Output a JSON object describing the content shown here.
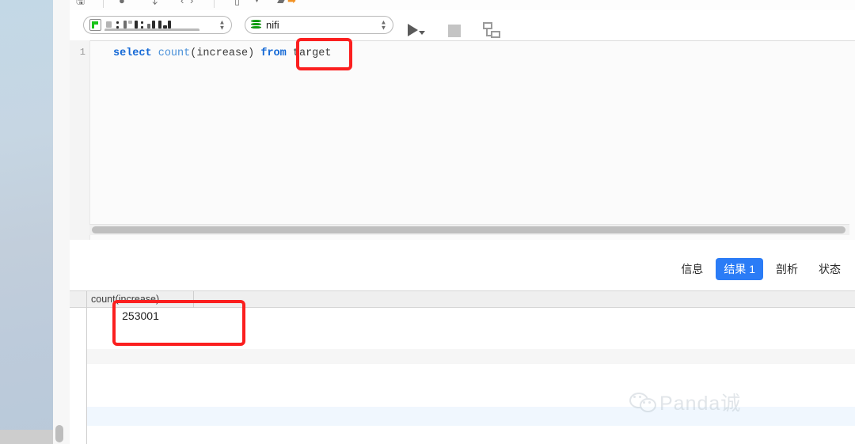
{
  "window": {
    "top_toolbar": {
      "icons": [
        "save-icon",
        "divider",
        "commit-icon",
        "rollback-icon",
        "navigate-back-icon",
        "navigate-forward-icon",
        "divider",
        "table-icon",
        "chevron-down-icon",
        "export-icon"
      ]
    }
  },
  "query_toolbar": {
    "connection": {
      "icon": "connection-icon",
      "label": "",
      "redacted": true,
      "stepper_up": "▲",
      "stepper_down": "▼"
    },
    "schema": {
      "icon": "database-icon",
      "label": "nifi",
      "stepper_up": "▲",
      "stepper_down": "▼"
    },
    "run_button_label": "run-query",
    "stop_button_label": "stop-query",
    "explain_plan_button_label": "explain-plan"
  },
  "editor": {
    "line_number": "1",
    "sql_tokens": [
      {
        "text": "select",
        "type": "keyword"
      },
      {
        "text": " ",
        "type": "plain"
      },
      {
        "text": "count",
        "type": "function"
      },
      {
        "text": "(increase) ",
        "type": "plain"
      },
      {
        "text": "from",
        "type": "keyword"
      },
      {
        "text": " ",
        "type": "plain"
      },
      {
        "text": "target",
        "type": "identifier"
      }
    ],
    "sql_text": "select count(increase) from target"
  },
  "results": {
    "tabs": [
      {
        "label": "信息",
        "active": false
      },
      {
        "label": "结果 1",
        "active": true
      },
      {
        "label": "剖析",
        "active": false
      },
      {
        "label": "状态",
        "active": false
      }
    ],
    "columns": [
      "count(increase)"
    ],
    "rows": [
      [
        "253001"
      ]
    ]
  },
  "annotations": [
    {
      "name": "annotation-target-table",
      "target": "target",
      "color": "#fb1f1f"
    },
    {
      "name": "annotation-result-value",
      "target": "253001",
      "color": "#fb1f1f"
    }
  ],
  "watermark": {
    "icon": "wechat-icon",
    "text": "Panda诚"
  },
  "colors": {
    "accent_blue": "#2b7cf6",
    "keyword_blue": "#1569d6",
    "function_blue": "#4a90d9",
    "annotation_red": "#fb1f1f",
    "db_green": "#13a813",
    "wallpaper": "#c3d8e6"
  }
}
